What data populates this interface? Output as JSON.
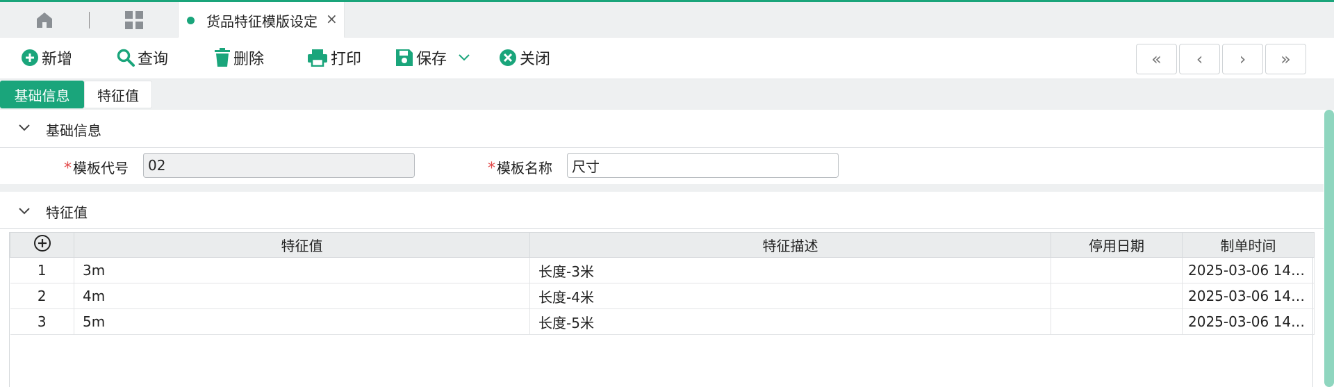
{
  "tabs": {
    "home_icon": "home-icon",
    "grid_icon": "grid-icon",
    "active_tab": {
      "title": "货品特征模版设定",
      "close": "×"
    }
  },
  "toolbar": {
    "add": "新增",
    "query": "查询",
    "delete": "删除",
    "print": "打印",
    "save": "保存",
    "close": "关闭",
    "nav": {
      "first": "«",
      "prev": "‹",
      "next": "›",
      "last": "»"
    }
  },
  "form_tabs": {
    "basic": "基础信息",
    "features": "特征值"
  },
  "basic_section": {
    "title": "基础信息",
    "code_label": "模板代号",
    "code_value": "02",
    "name_label": "模板名称",
    "name_value": "尺寸",
    "required_mark": "*"
  },
  "feature_section": {
    "title": "特征值",
    "columns": [
      "特征值",
      "特征描述",
      "停用日期",
      "制单时间"
    ],
    "rows": [
      {
        "no": "1",
        "value": "3m",
        "desc": "长度-3米",
        "stop_date": "",
        "created": "2025-03-06 14:..."
      },
      {
        "no": "2",
        "value": "4m",
        "desc": "长度-4米",
        "stop_date": "",
        "created": "2025-03-06 14:..."
      },
      {
        "no": "3",
        "value": "5m",
        "desc": "长度-5米",
        "stop_date": "",
        "created": "2025-03-06 14:..."
      }
    ]
  },
  "colors": {
    "accent": "#1aa57b",
    "required": "#e24a4a"
  }
}
